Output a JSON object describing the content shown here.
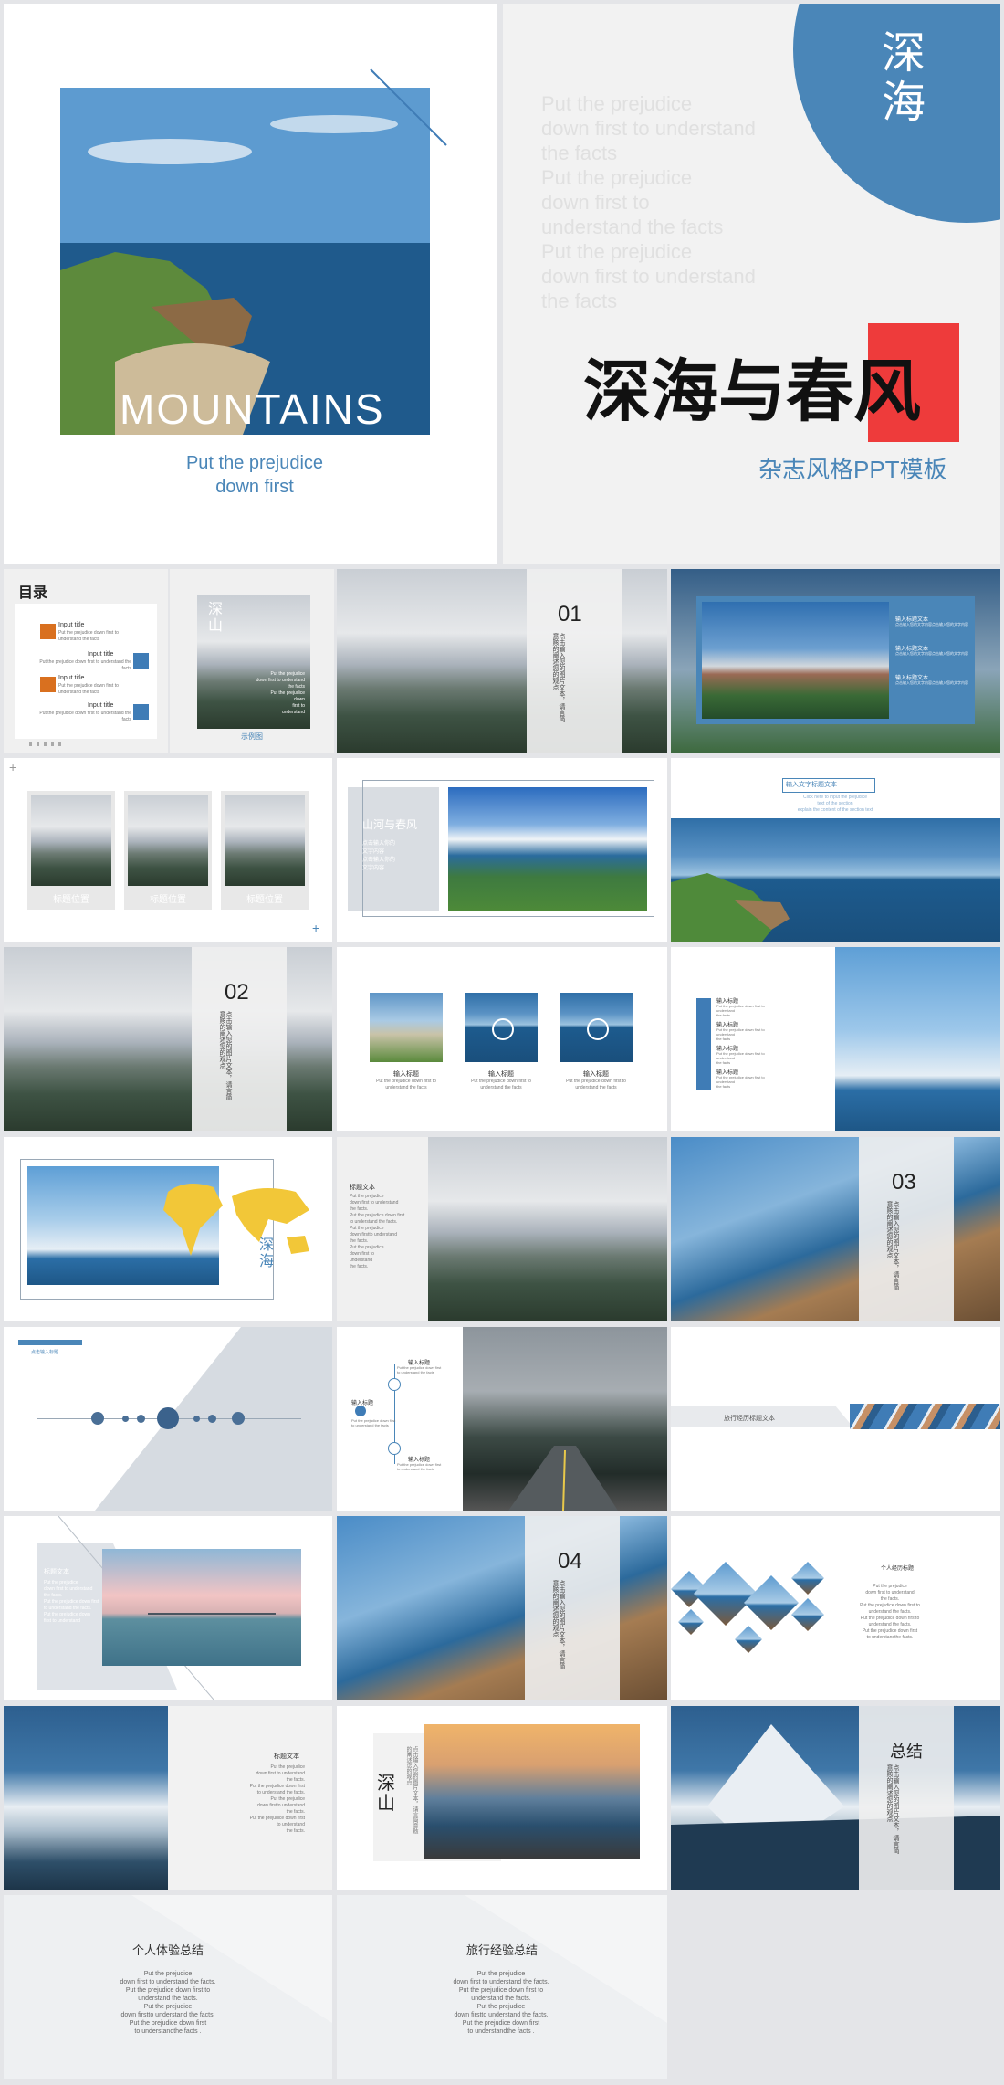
{
  "hero": {
    "mountains_word": "MOUNTAINS",
    "tagline": "Put the prejudice\ndown first",
    "circle_chars": "深\n海",
    "faded_text": "Put the prejudice\ndown first to understand\nthe facts\nPut the prejudice\ndown first to\nunderstand the facts\nPut the prejudice\ndown first to understand\nthe facts",
    "main_title": "深海与春风",
    "subtitle": "杂志风格PPT模板",
    "colors": {
      "accent_blue": "#4a86b8",
      "accent_red": "#ee3b3b"
    }
  },
  "toc": {
    "title": "目录",
    "items": [
      {
        "title": "Input title",
        "desc": "Put the prejudice down first to understand the facts"
      },
      {
        "title": "Input title",
        "desc": "Put the prejudice down first to understand the facts"
      },
      {
        "title": "Input title",
        "desc": "Put the prejudice down first to understand the facts"
      },
      {
        "title": "Input title",
        "desc": "Put the prejudice down first to understand the facts"
      }
    ]
  },
  "s_deep_mountain": {
    "chars": "深\n山",
    "lines": "Put the prejudice\ndown first to understand\nthe facts\nPut the prejudice\ndown\nfirst to\nunderstand",
    "caption": "示例图"
  },
  "section1": {
    "number": "01",
    "vtext": "点击输入您的图片文本，请言简意赅的阐述您的观点"
  },
  "s_four": {
    "items": [
      "输入标题文本",
      "输入标题文本",
      "输入标题文本"
    ],
    "sub": "点击输入您的文字内容点击输入您的文字内容"
  },
  "s_three_photos": {
    "labels": [
      "标题位置",
      "标题位置",
      "标题位置"
    ]
  },
  "s_spring": {
    "title": "山河与春风",
    "lines": "点击输入你的\n文字内容\n点击输入你的\n文字内容"
  },
  "s_wide": {
    "title": "输入文字标题文本",
    "sub": "Click here to input the prejudice\ntext of the section\nexplain the content of the section text"
  },
  "section2": {
    "number": "02",
    "vtext": "点击输入您的图片文本，请言简意赅的阐述您的观点"
  },
  "s_circles": {
    "items": [
      {
        "title": "输入标题",
        "desc": "Put the prejudice down first to\nunderstand the facts"
      },
      {
        "title": "输入标题",
        "desc": "Put the prejudice down first to\nunderstand the facts"
      },
      {
        "title": "输入标题",
        "desc": "Put the prejudice down first to\nunderstand the facts"
      }
    ]
  },
  "s_boat": {
    "items": [
      {
        "title": "输入标题",
        "desc": "Put the prejudice down first to\nunderstand\nthe facts"
      },
      {
        "title": "输入标题",
        "desc": "Put the prejudice down first to\nunderstand\nthe facts"
      },
      {
        "title": "输入标题",
        "desc": "Put the prejudice down first to\nunderstand\nthe facts"
      },
      {
        "title": "输入标题",
        "desc": "Put the prejudice down first to\nunderstand\nthe facts"
      }
    ]
  },
  "s_map": {
    "chars": "深\n海"
  },
  "s_label_text": {
    "title": "标题文本",
    "lines": "Put the prejudice\ndown first to understand\nthe facts.\nPut the prejudice down first\nto understand the facts.\nPut the prejudice\ndown firstto understand\nthe facts.\nPut the prejudice\ndown first to\nunderstand\nthe facts."
  },
  "section3": {
    "number": "03",
    "vtext": "点击输入您的图片文本，请言简意赅的阐述您的观点"
  },
  "s_timeline": {
    "label": "点击输入标题"
  },
  "s_road": {
    "items": [
      {
        "title": "输入标题",
        "desc": "Put the prejudice down first\nto understand the facts"
      },
      {
        "title": "输入标题",
        "desc": "Put the prejudice down first\nto understand the facts"
      },
      {
        "title": "输入标题",
        "desc": "Put the prejudice down first\nto understand the facts"
      }
    ]
  },
  "s_banner": {
    "label": "旅行经历标题文本"
  },
  "s_pier": {
    "title": "标题文本",
    "lines": "Put the prejudice\ndown first to understand\nthe facts.\nPut the prejudice down first\nto understand the facts.\nPut the prejudice down\nfirst to understand"
  },
  "section4": {
    "number": "04",
    "vtext": "点击输入您的图片文本，请言简意赅的阐述您的观点"
  },
  "s_diamond": {
    "title": "个人经历标题",
    "lines": "Put the prejudice\ndown first to understand\nthe facts.\nPut the prejudice down first to\nunderstand the facts.\nPut the prejudice down firstto\nunderstand the facts.\nPut the prejudice down first\nto understandthe facts."
  },
  "s_snow_left": {
    "title": "标题文本",
    "lines": "Put the prejudice\ndown first to understand\nthe facts.\nPut the prejudice down first\nto understand the facts.\nPut the prejudice\ndown firstto understand\nthe facts.\nPut the prejudice down first\nto understand\nthe facts."
  },
  "s_sunset": {
    "chars": "深\n山",
    "vtext": "点击输入您的图片文本，请言简意赅的阐述您的观点"
  },
  "summary": {
    "title": "总结",
    "vtext": "点击输入您的图片文本，请言简意赅的阐述您的观点"
  },
  "end1": {
    "title": "个人体验总结",
    "lines": "Put the prejudice\ndown first to understand the facts.\nPut the prejudice down first to\nunderstand the facts.\nPut the prejudice\ndown firstto understand the facts.\nPut the prejudice down first\nto understandthe facts ."
  },
  "end2": {
    "title": "旅行经验总结",
    "lines": "Put the prejudice\ndown first to understand the facts.\nPut the prejudice down first to\nunderstand the facts.\nPut the prejudice\ndown firstto understand the facts.\nPut the prejudice down first\nto understandthe facts ."
  }
}
